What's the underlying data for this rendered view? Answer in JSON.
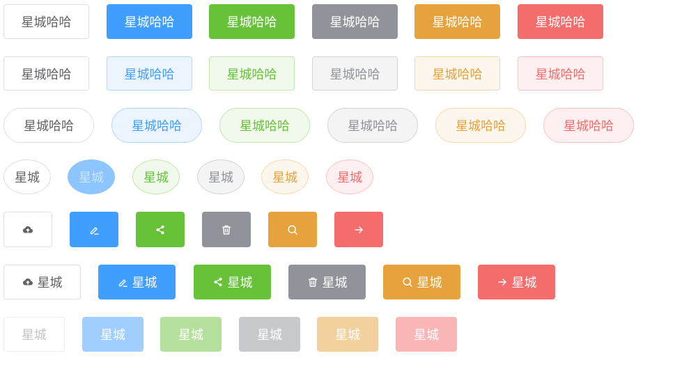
{
  "colors": {
    "default_text": "#606266",
    "default_border": "#dcdfe6",
    "primary": "#409eff",
    "success": "#67c23a",
    "info": "#909399",
    "warning": "#e6a23c",
    "danger": "#f56c6c"
  },
  "label_long": "星城哈哈",
  "label_short": "星城",
  "icons": [
    "upload-cloud-icon",
    "edit-icon",
    "share-icon",
    "delete-icon",
    "search-icon",
    "arrow-right-icon"
  ]
}
